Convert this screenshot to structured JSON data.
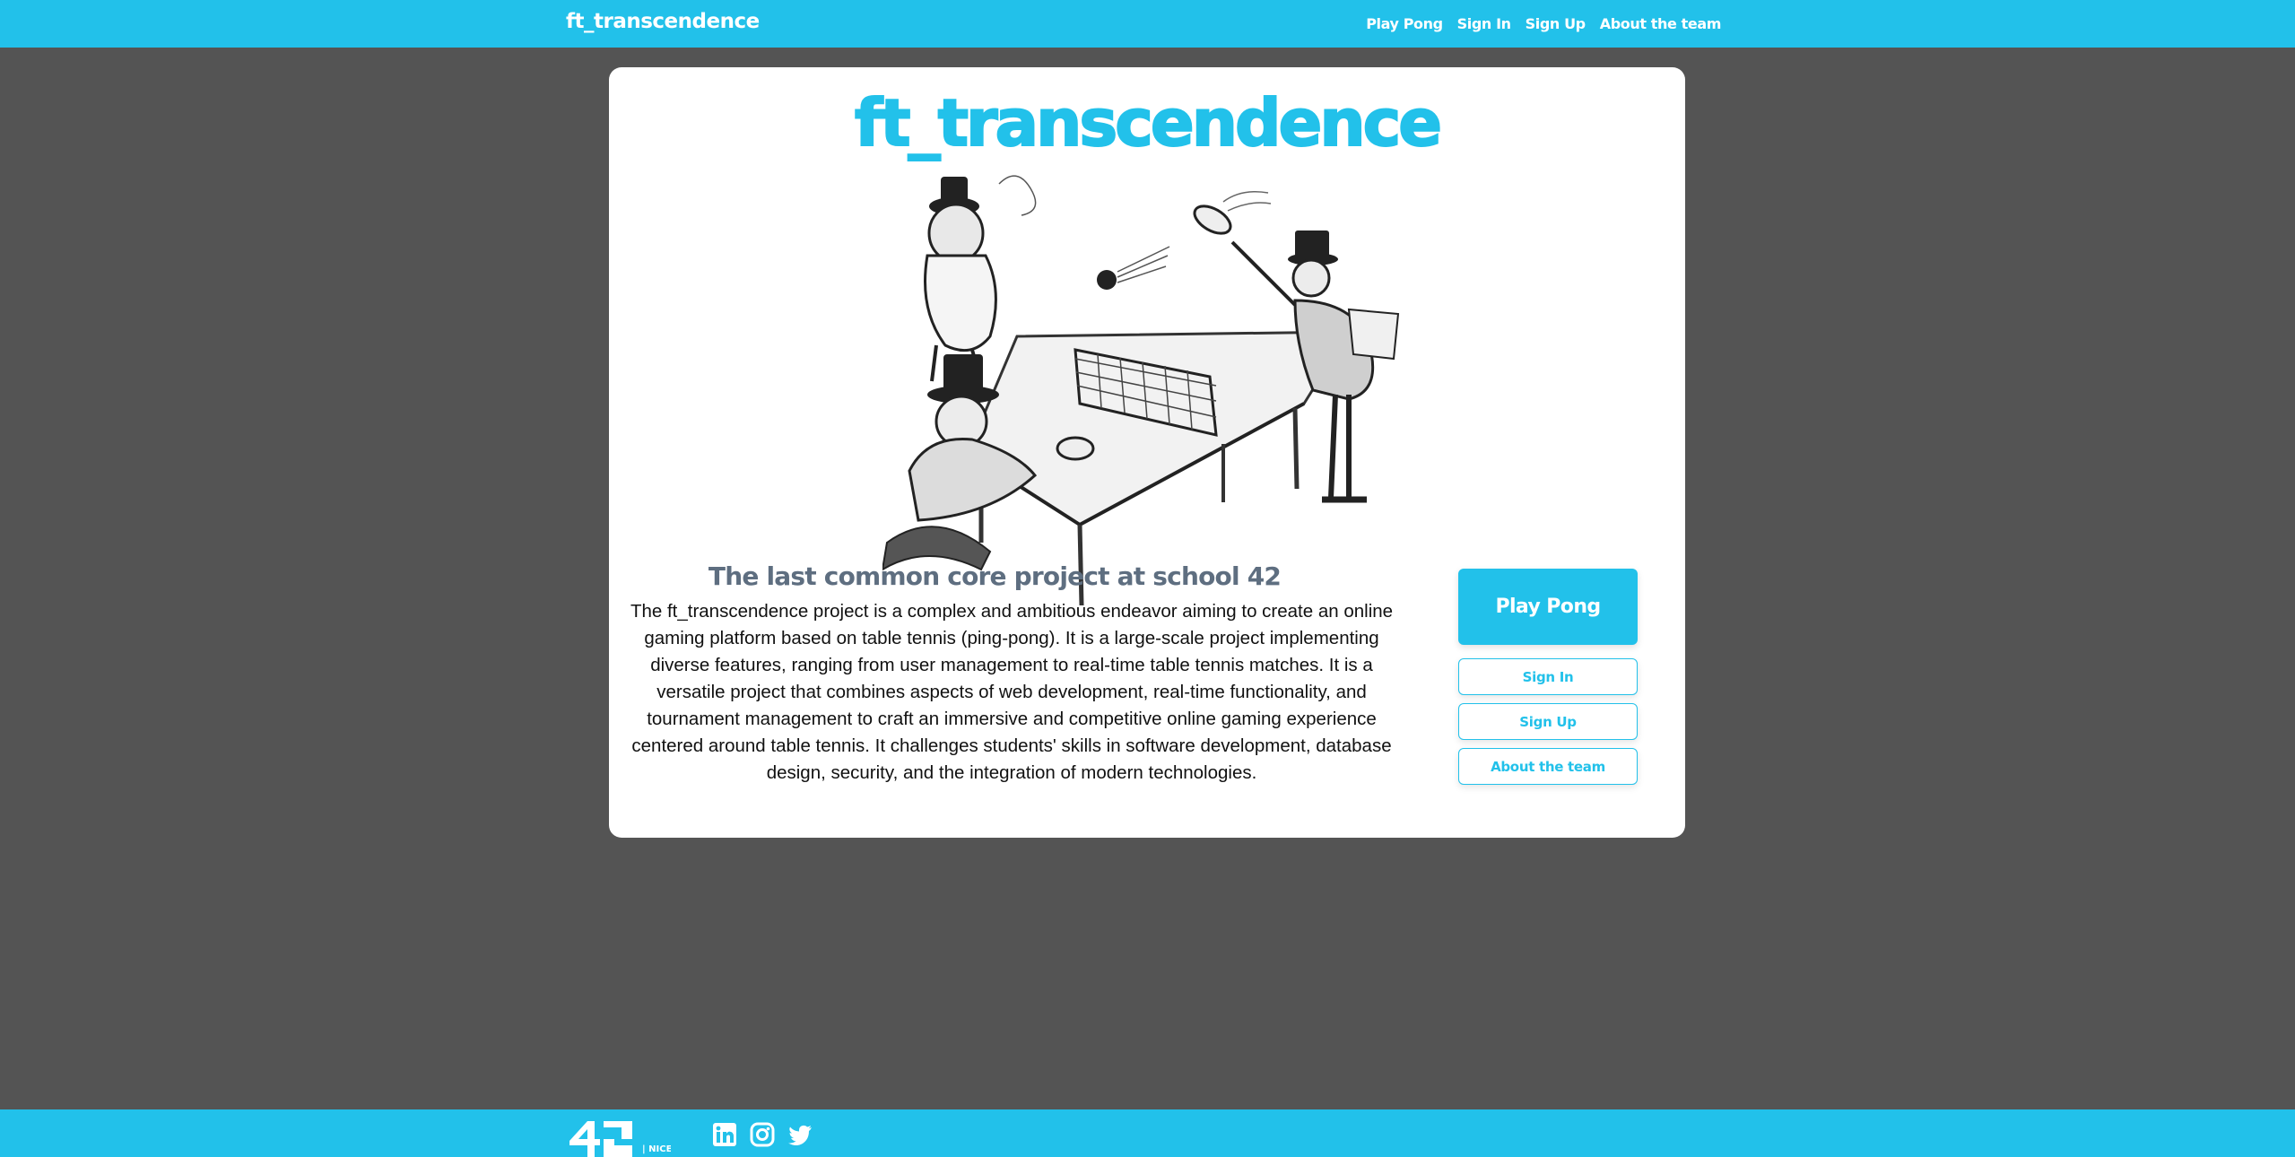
{
  "nav": {
    "brand": "ft_transcendence",
    "links": [
      "Play Pong",
      "Sign In",
      "Sign Up",
      "About the team"
    ]
  },
  "main": {
    "title": "ft_transcendence",
    "subtitle": "The last common core project at school 42",
    "description": "The ft_transcendence project is a complex and ambitious endeavor aiming to create an online gaming platform based on table tennis (ping-pong). It is a large-scale project implementing diverse features, ranging from user management to real-time table tennis matches. It is a versatile project that combines aspects of web development, real-time functionality, and tournament management to craft an immersive and competitive online gaming experience centered around table tennis. It challenges students' skills in software development, database design, security, and the integration of modern technologies.",
    "buttons": {
      "play": "Play Pong",
      "signin": "Sign In",
      "signup": "Sign Up",
      "about": "About the team"
    }
  },
  "footer": {
    "logo_text": "42",
    "logo_sub": "| NICE",
    "icons": [
      "linkedin-icon",
      "instagram-icon",
      "twitter-icon"
    ]
  },
  "colors": {
    "accent": "#22c1ea",
    "background": "#545454",
    "card": "#ffffff",
    "subtitle": "#5e6e80"
  }
}
